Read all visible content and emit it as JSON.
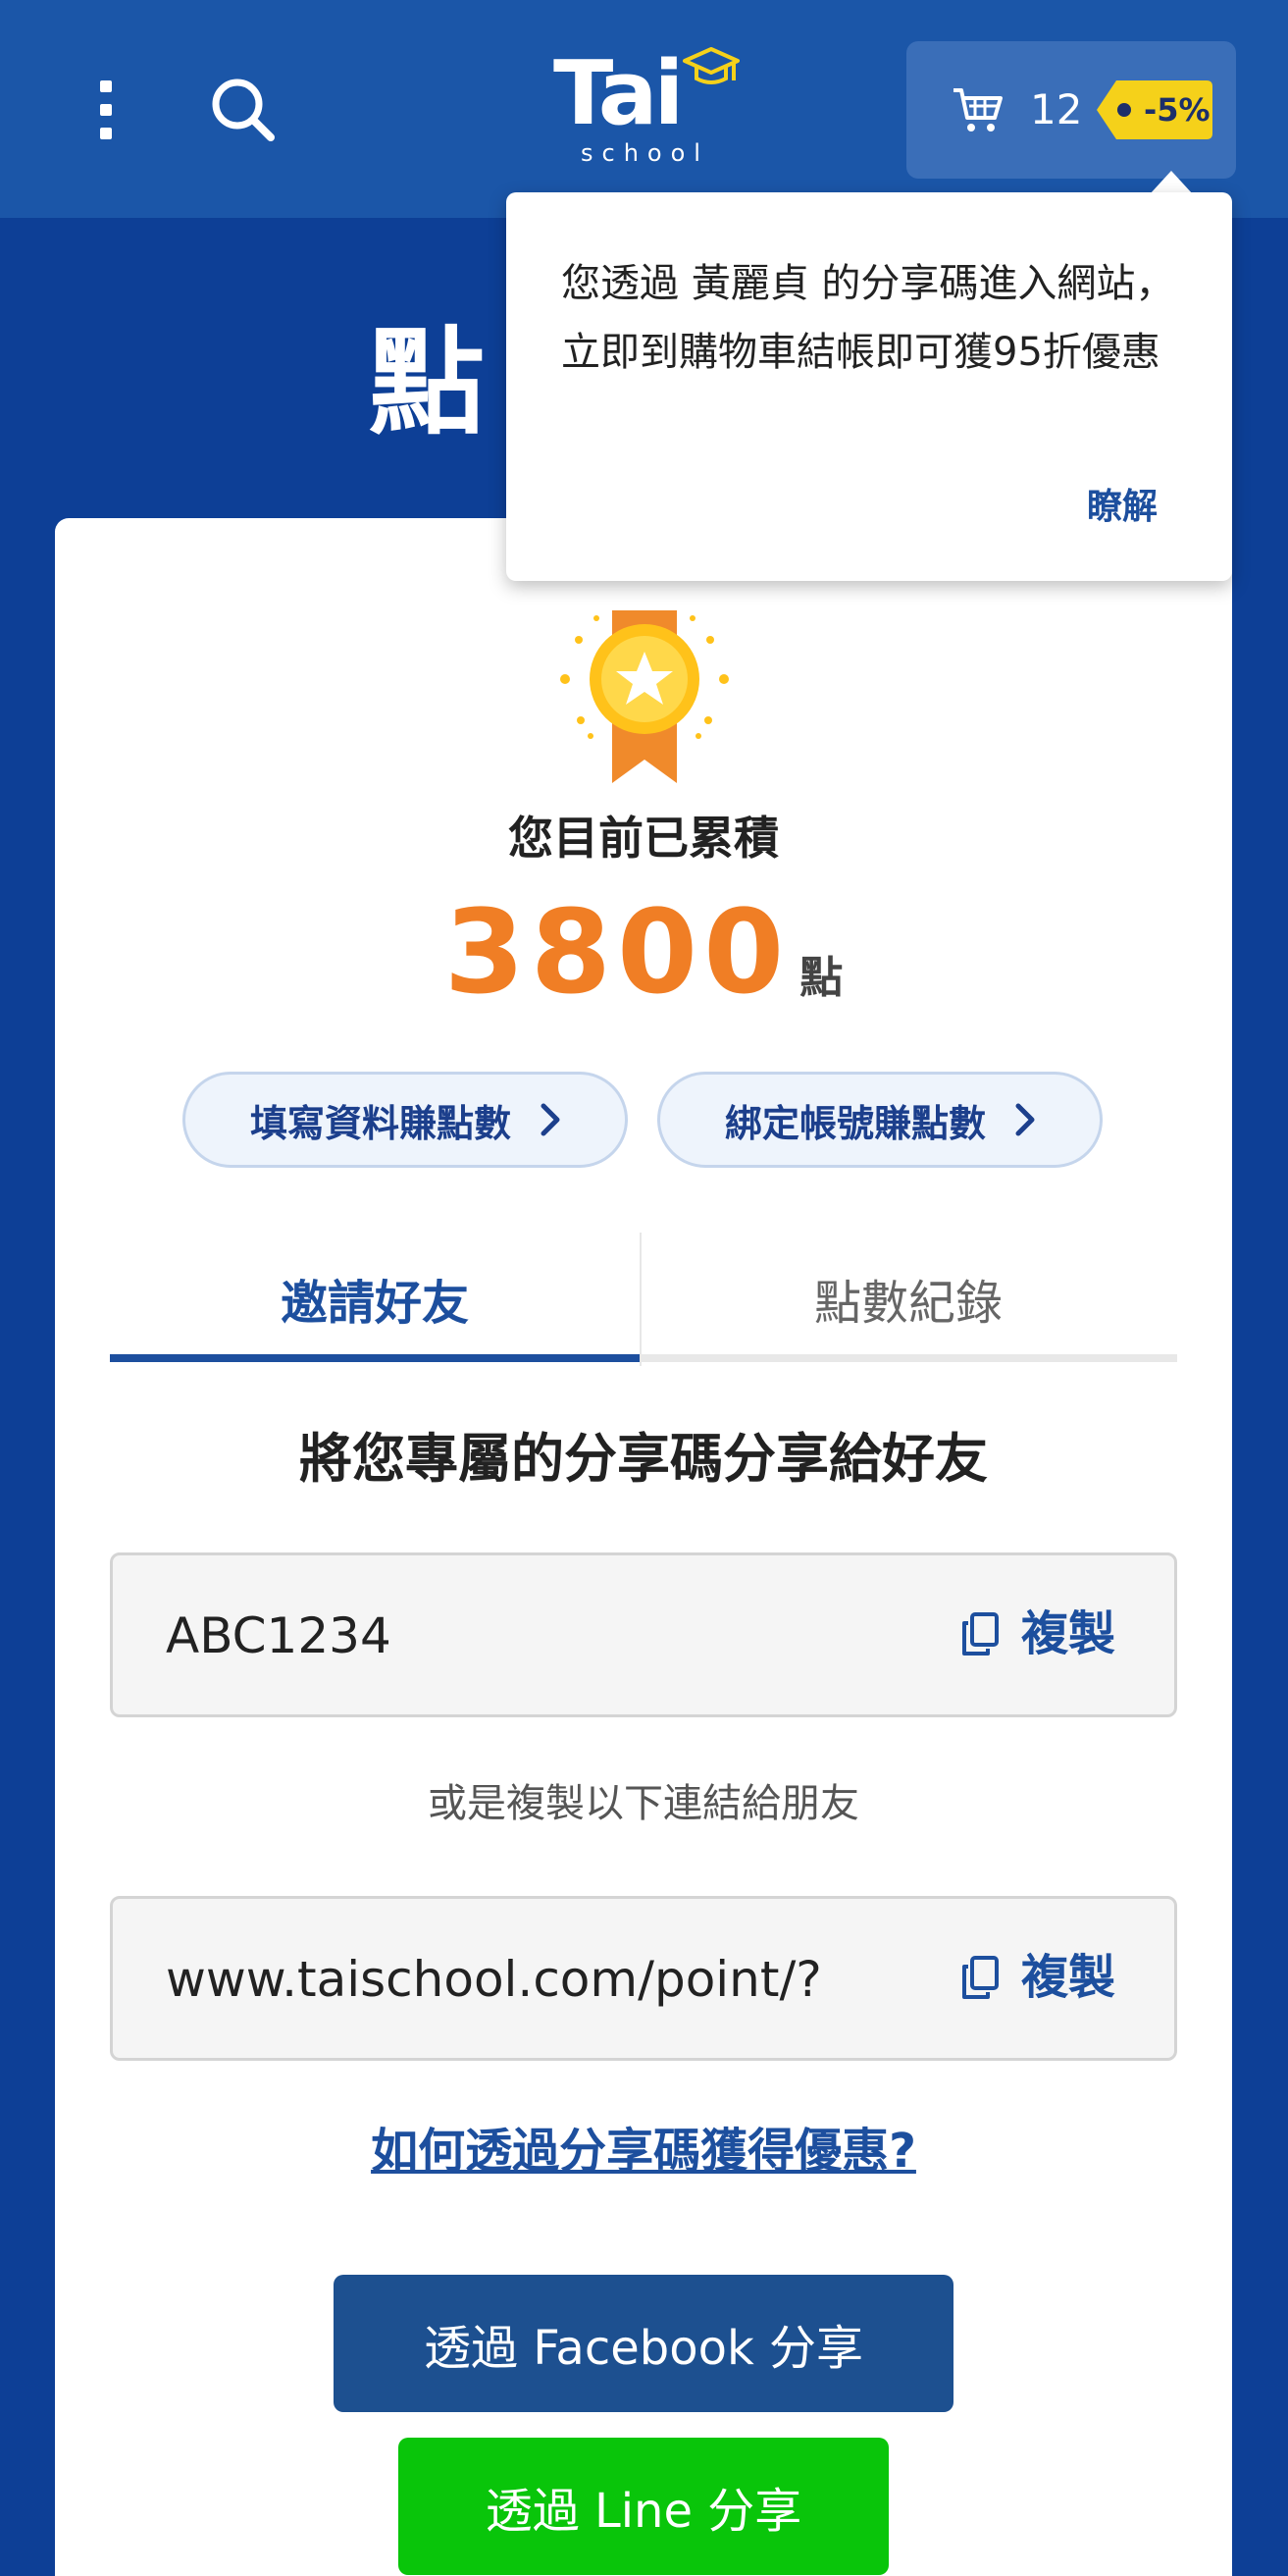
{
  "header": {
    "logo_text": "Tai",
    "logo_sub": "school",
    "cart_count": "12",
    "discount_badge": "-5%"
  },
  "page": {
    "title": "點"
  },
  "popover": {
    "message": "您透過 黃麗貞 的分享碼進入網站，立即到購物車結帳即可獲95折優惠",
    "ok_label": "瞭解"
  },
  "points": {
    "label": "您目前已累積",
    "value": "3800",
    "unit": "點"
  },
  "actions": {
    "fill_info": "填寫資料賺點數",
    "bind_account": "綁定帳號賺點數"
  },
  "tabs": [
    {
      "label": "邀請好友",
      "active": true
    },
    {
      "label": "點數紀錄",
      "active": false
    }
  ],
  "invite": {
    "heading": "將您專屬的分享碼分享給好友",
    "code": "ABC1234",
    "copy_label": "複製",
    "or_text": "或是複製以下連結給朋友",
    "link": "www.taischool.com/point/?",
    "how_link": "如何透過分享碼獲得優惠?",
    "facebook_btn": "透過 Facebook 分享",
    "line_btn": "透過 Line 分享"
  },
  "colors": {
    "header_bg": "#1b56a8",
    "page_bg": "#0d3f96",
    "accent": "#1d4f9e",
    "points": "#f07e25",
    "facebook": "#1d5090",
    "line": "#09c50a",
    "badge": "#f5d11a"
  }
}
